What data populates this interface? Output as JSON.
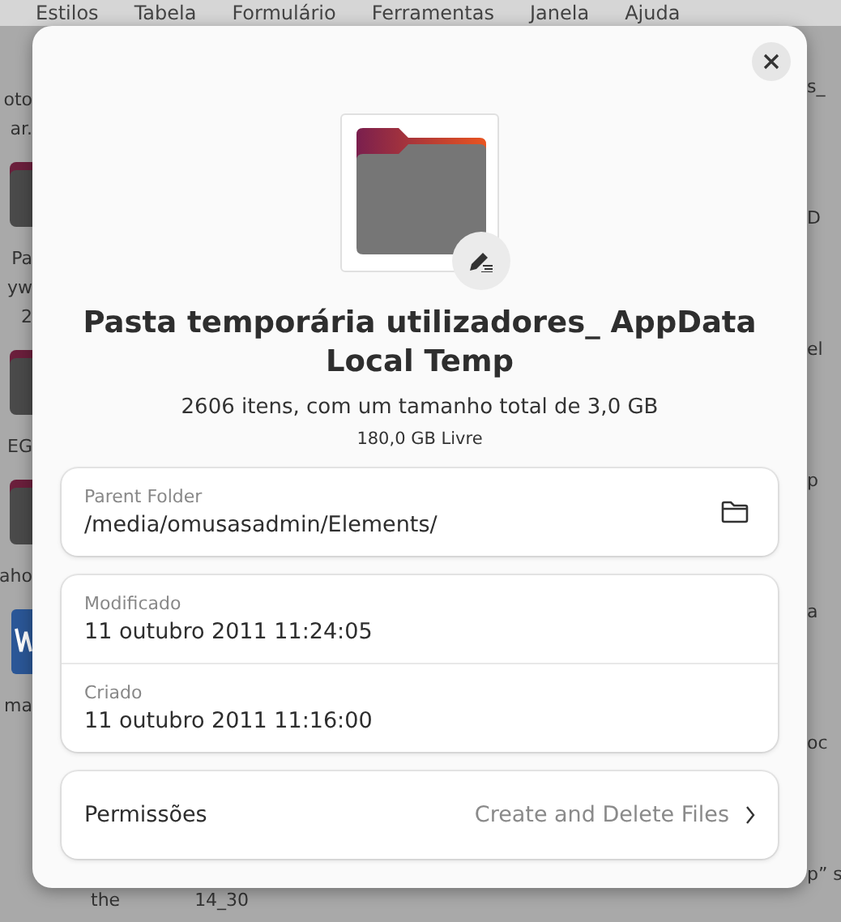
{
  "background": {
    "menu": [
      "Estilos",
      "Tabela",
      "Formulário",
      "Ferramentas",
      "Janela",
      "Ajuda"
    ],
    "left_items": [
      {
        "kind": "text",
        "text": "oto"
      },
      {
        "kind": "text",
        "text": "ar."
      },
      {
        "kind": "folder"
      },
      {
        "kind": "text",
        "text": "Pa"
      },
      {
        "kind": "text",
        "text": "yw"
      },
      {
        "kind": "text",
        "text": "2"
      },
      {
        "kind": "folder"
      },
      {
        "kind": "text",
        "text": "EG"
      },
      {
        "kind": "folder"
      },
      {
        "kind": "text",
        "text": "aho"
      },
      {
        "kind": "document"
      },
      {
        "kind": "text",
        "text": "ma"
      }
    ],
    "right_items": [
      "s_",
      "D",
      "el",
      "p",
      "a",
      "oc",
      "p” s"
    ],
    "bottom_items": [
      "the",
      "14_30"
    ]
  },
  "dialog": {
    "title": "Pasta temporária utilizadores_ AppData Local Temp",
    "summary": "2606 itens, com um tamanho total de 3,0 GB",
    "free_space": "180,0 GB Livre",
    "parent": {
      "label": "Parent Folder",
      "value": "/media/omusasadmin/Elements/"
    },
    "dates": [
      {
        "label": "Modificado",
        "value": "11 outubro 2011 11:24:05"
      },
      {
        "label": "Criado",
        "value": "11 outubro 2011 11:16:00"
      }
    ],
    "permissions": {
      "label": "Permissões",
      "value": "Create and Delete Files"
    }
  }
}
